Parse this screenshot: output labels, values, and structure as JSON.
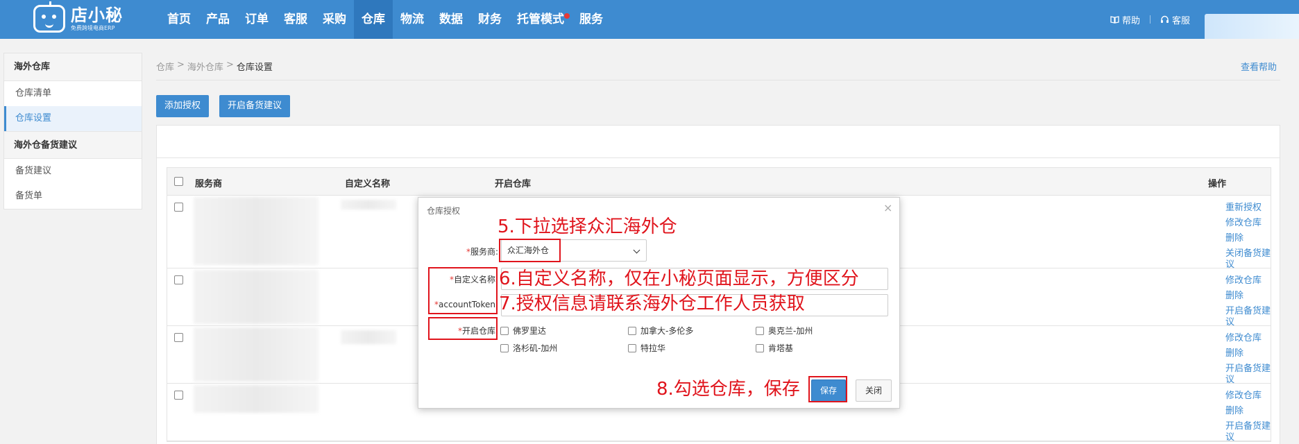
{
  "logo": {
    "name": "店小秘",
    "sub": "免费跨境电商ERP"
  },
  "nav": {
    "items": [
      "首页",
      "产品",
      "订单",
      "客服",
      "采购",
      "仓库",
      "物流",
      "数据",
      "财务",
      "托管模式",
      "服务"
    ],
    "active": "仓库"
  },
  "topright": {
    "help": "帮助",
    "service": "客服"
  },
  "sidebar": {
    "group1": "海外仓库",
    "item1": "仓库清单",
    "item2": "仓库设置",
    "group2": "海外仓备货建议",
    "item3": "备货建议",
    "item4": "备货单"
  },
  "breadcrumb": {
    "level1": "仓库",
    "level2": "海外仓库",
    "current": "仓库设置",
    "separator": ">"
  },
  "help_link": "查看帮助",
  "buttons": {
    "add_auth": "添加授权",
    "stock_suggest": "开启备货建议"
  },
  "table": {
    "headers": {
      "provider": "服务商",
      "custom_name": "自定义名称",
      "open_warehouse": "开启仓库",
      "actions": "操作"
    },
    "rows": [
      {
        "ops": [
          "重新授权",
          "修改仓库",
          "删除",
          "关闭备货建议"
        ]
      },
      {
        "ops": [
          "修改仓库",
          "删除",
          "开启备货建议"
        ]
      },
      {
        "ops": [
          "修改仓库",
          "删除",
          "开启备货建议"
        ]
      },
      {
        "ops": [
          "修改仓库",
          "删除",
          "开启备货建议"
        ]
      }
    ]
  },
  "modal": {
    "title": "仓库授权",
    "close": "×",
    "required_mark": "*",
    "provider_label": "服务商:",
    "provider_value": "众汇海外仓",
    "custom_name_label": "自定义名称:",
    "custom_name_value": "",
    "token_label": "accountToken:",
    "token_value": "",
    "warehouse_label": "开启仓库:",
    "warehouses": [
      "佛罗里达",
      "加拿大-多伦多",
      "奥克兰-加州",
      "洛杉矶-加州",
      "特拉华",
      "肯塔基"
    ],
    "save": "保存",
    "close_btn": "关闭"
  },
  "annotations": {
    "step5": "5.下拉选择众汇海外仓",
    "step6": "6.自定义名称，仅在小秘页面显示，方便区分",
    "step7": "7.授权信息请联系海外仓工作人员获取",
    "step8": "8.勾选仓库，保存"
  },
  "colors": {
    "nav_bg": "#3e8bd0",
    "nav_active": "#2f78bd",
    "accent": "#3e8bd0",
    "annotation": "#e0141c"
  }
}
